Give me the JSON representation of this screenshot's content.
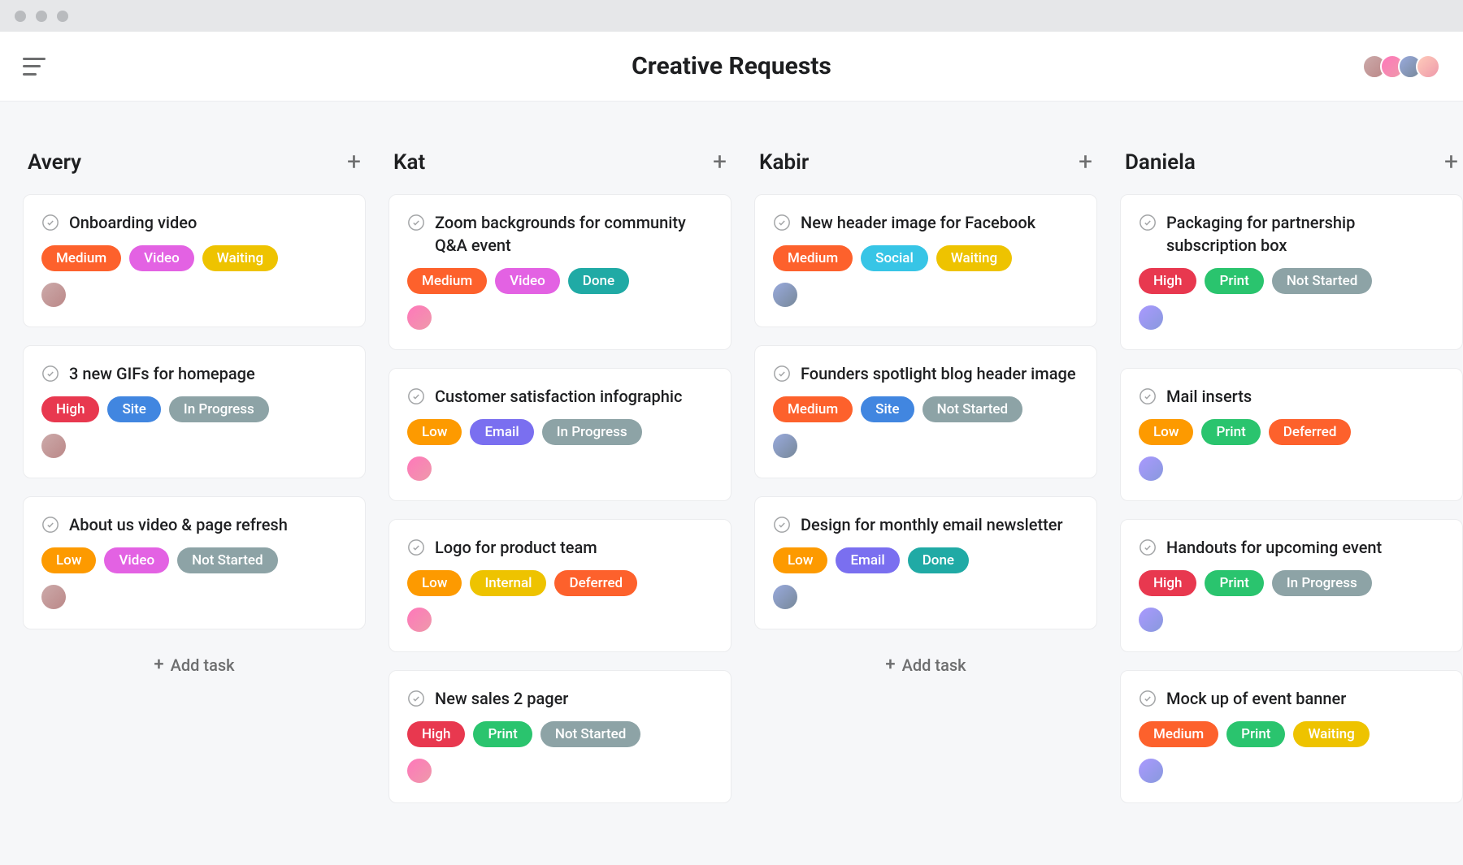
{
  "header": {
    "title": "Creative Requests",
    "avatars": [
      "p0",
      "p1",
      "p2",
      "p3"
    ]
  },
  "addTaskLabel": "Add task",
  "tagColors": {
    "Medium": "#fd612c",
    "High": "#e8384f",
    "Low": "#fd9a00",
    "Video": "#e362e3",
    "Social": "#37c5e6",
    "Site": "#4186e0",
    "Email": "#7a6ff0",
    "Print": "#2ac46e",
    "Internal": "#eec300",
    "Waiting": "#eec300",
    "Done": "#20aaa5",
    "In Progress": "#8da3a6",
    "Not Started": "#8da3a6",
    "Deferred": "#fd612c"
  },
  "columns": [
    {
      "name": "Avery",
      "showAdd": true,
      "cards": [
        {
          "title": "Onboarding video",
          "tags": [
            "Medium",
            "Video",
            "Waiting"
          ],
          "assignee": "p0"
        },
        {
          "title": "3 new GIFs for homepage",
          "tags": [
            "High",
            "Site",
            "In Progress"
          ],
          "assignee": "p0"
        },
        {
          "title": "About us video & page refresh",
          "tags": [
            "Low",
            "Video",
            "Not Started"
          ],
          "assignee": "p0"
        }
      ]
    },
    {
      "name": "Kat",
      "showAdd": false,
      "cards": [
        {
          "title": "Zoom backgrounds for community Q&A event",
          "tags": [
            "Medium",
            "Video",
            "Done"
          ],
          "assignee": "p1"
        },
        {
          "title": "Customer satisfaction infographic",
          "tags": [
            "Low",
            "Email",
            "In Progress"
          ],
          "assignee": "p1"
        },
        {
          "title": "Logo for product team",
          "tags": [
            "Low",
            "Internal",
            "Deferred"
          ],
          "assignee": "p1"
        },
        {
          "title": "New sales 2 pager",
          "tags": [
            "High",
            "Print",
            "Not Started"
          ],
          "assignee": "p1"
        }
      ]
    },
    {
      "name": "Kabir",
      "showAdd": true,
      "cards": [
        {
          "title": "New header image for Facebook",
          "tags": [
            "Medium",
            "Social",
            "Waiting"
          ],
          "assignee": "p2"
        },
        {
          "title": "Founders spotlight blog header image",
          "tags": [
            "Medium",
            "Site",
            "Not Started"
          ],
          "assignee": "p2"
        },
        {
          "title": "Design for monthly email newsletter",
          "tags": [
            "Low",
            "Email",
            "Done"
          ],
          "assignee": "p2"
        }
      ]
    },
    {
      "name": "Daniela",
      "showAdd": false,
      "cards": [
        {
          "title": "Packaging for partnership subscription box",
          "tags": [
            "High",
            "Print",
            "Not Started"
          ],
          "assignee": "p4"
        },
        {
          "title": "Mail inserts",
          "tags": [
            "Low",
            "Print",
            "Deferred"
          ],
          "assignee": "p4"
        },
        {
          "title": "Handouts for upcoming event",
          "tags": [
            "High",
            "Print",
            "In Progress"
          ],
          "assignee": "p4"
        },
        {
          "title": "Mock up of event banner",
          "tags": [
            "Medium",
            "Print",
            "Waiting"
          ],
          "assignee": "p4"
        }
      ]
    }
  ]
}
